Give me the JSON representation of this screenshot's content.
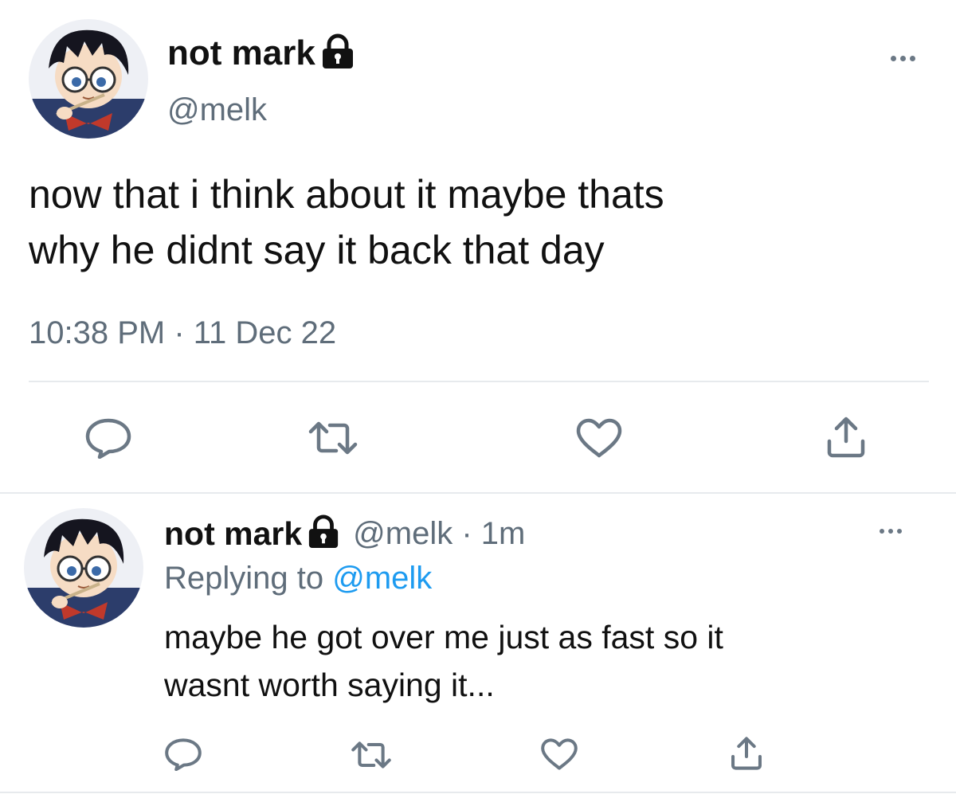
{
  "main_tweet": {
    "display_name": "not mark",
    "handle": "@melk",
    "text_line_1": "now that i think about it maybe thats",
    "text_line_2": "why he didnt say it back that day",
    "time": "10:38 PM",
    "separator": " · ",
    "date": "11 Dec 22"
  },
  "reply_tweet": {
    "display_name": "not mark",
    "handle": "@melk",
    "separator": " · ",
    "age": "1m",
    "replying_label": "Replying to ",
    "replying_handle": "@melk",
    "text_line_1": "maybe he got over me just as fast so it",
    "text_line_2": "wasnt worth saying it..."
  },
  "icons": {
    "lock": "lock-icon",
    "more": "more-dots-icon",
    "reply": "reply-icon",
    "retweet": "retweet-icon",
    "like": "heart-icon",
    "share": "share-icon"
  },
  "colors": {
    "text": "#111111",
    "secondary": "#5f6d7a",
    "link": "#1d9bf0",
    "icon": "#6b7885",
    "divider": "#e7eaed"
  }
}
